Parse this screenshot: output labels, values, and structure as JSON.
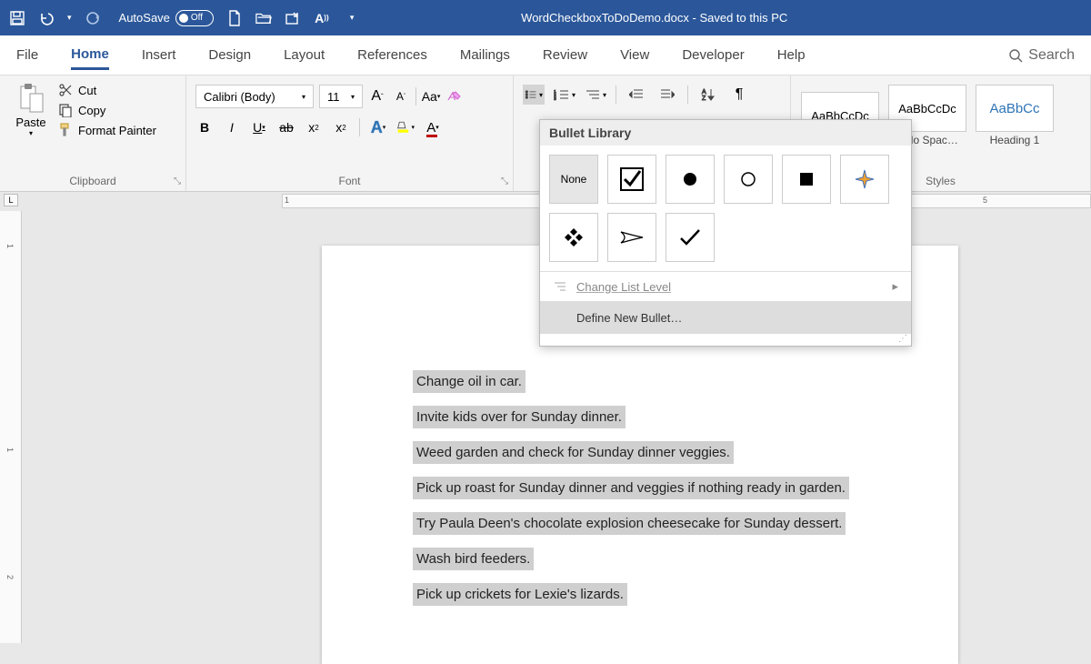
{
  "title_bar": {
    "autosave_label": "AutoSave",
    "autosave_state": "Off",
    "doc_title": "WordCheckboxToDoDemo.docx  -  Saved to this PC"
  },
  "tabs": {
    "file": "File",
    "home": "Home",
    "insert": "Insert",
    "design": "Design",
    "layout": "Layout",
    "references": "References",
    "mailings": "Mailings",
    "review": "Review",
    "view": "View",
    "developer": "Developer",
    "help": "Help",
    "search": "Search"
  },
  "ribbon": {
    "clipboard": {
      "paste": "Paste",
      "cut": "Cut",
      "copy": "Copy",
      "format_painter": "Format Painter",
      "label": "Clipboard"
    },
    "font": {
      "name": "Calibri (Body)",
      "size": "11",
      "label": "Font"
    },
    "styles": {
      "preview1": "AaBbCcDc",
      "preview2": "AaBbCcDc",
      "preview3": "AaBbCc",
      "name2": "¶ No Spac…",
      "name3": "Heading 1",
      "label": "Styles"
    }
  },
  "bullet_popup": {
    "header": "Bullet Library",
    "none": "None",
    "change_level": "Change List Level",
    "define_new": "Define New Bullet…"
  },
  "document": {
    "lines": [
      "Change oil in car.",
      "Invite kids over for Sunday dinner.",
      "Weed garden and check for Sunday dinner veggies.",
      "Pick up roast for Sunday dinner and veggies if nothing ready in garden.",
      "Try Paula Deen's chocolate explosion cheesecake for Sunday dessert.",
      "Wash bird feeders.",
      "Pick up crickets for Lexie's lizards."
    ]
  },
  "ruler": {
    "mark1": "1",
    "mark5": "5"
  }
}
